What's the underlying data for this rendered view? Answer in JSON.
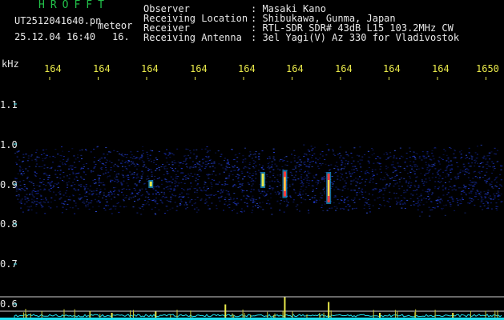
{
  "header": {
    "brand": "HROFFT",
    "filename": "UT2512041640.pn",
    "meteor_label": "meteor",
    "datetime": "25.12.04 16:40",
    "extra": "16.",
    "fields": [
      {
        "label": "Observer",
        "value": ": Masaki Kano"
      },
      {
        "label": "Receiving Location",
        "value": ": Shibukawa, Gunma, Japan"
      },
      {
        "label": "Receiver",
        "value": ": RTL-SDR SDR# 43dB L15 103.2MHz CW"
      },
      {
        "label": "Receiving Antenna",
        "value": ": 3el Yagi(V) Az 330 for Vladivostok"
      }
    ]
  },
  "colors": {
    "background": "#000000",
    "text": "#e8e8e8",
    "brand": "#22c24a",
    "ticks": "#e8e84a",
    "axis": "#3fe0f0",
    "noise": "#1a2fb8",
    "trace": "#20e0f0"
  },
  "chart_data": {
    "type": "heatmap",
    "title": "",
    "xlabel": "",
    "ylabel": "kHz",
    "x_ticks": [
      "164",
      "164",
      "164",
      "164",
      "164",
      "164",
      "164",
      "164",
      "164",
      "1650"
    ],
    "y_ticks": [
      "1.1",
      "1.0",
      "0.9",
      "0.8",
      "0.7",
      "0.6"
    ],
    "ylim": [
      0.58,
      1.14
    ],
    "noise_band_khz": [
      0.82,
      1.0
    ],
    "echoes": [
      {
        "x_frac": 0.28,
        "center_khz": 0.9,
        "span_khz": 0.02,
        "intensity": 0.5
      },
      {
        "x_frac": 0.51,
        "center_khz": 0.91,
        "span_khz": 0.04,
        "intensity": 0.7
      },
      {
        "x_frac": 0.555,
        "center_khz": 0.9,
        "span_khz": 0.07,
        "intensity": 1.0
      },
      {
        "x_frac": 0.645,
        "center_khz": 0.89,
        "span_khz": 0.08,
        "intensity": 1.0
      }
    ],
    "spectrum_peaks": [
      {
        "x_frac": 0.433,
        "level": 0.55
      },
      {
        "x_frac": 0.555,
        "level": 0.85
      },
      {
        "x_frac": 0.645,
        "level": 0.65
      },
      {
        "x_frac": 0.29,
        "level": 0.25
      },
      {
        "x_frac": 0.2,
        "level": 0.2
      },
      {
        "x_frac": 0.75,
        "level": 0.2
      },
      {
        "x_frac": 0.9,
        "level": 0.2
      }
    ]
  }
}
